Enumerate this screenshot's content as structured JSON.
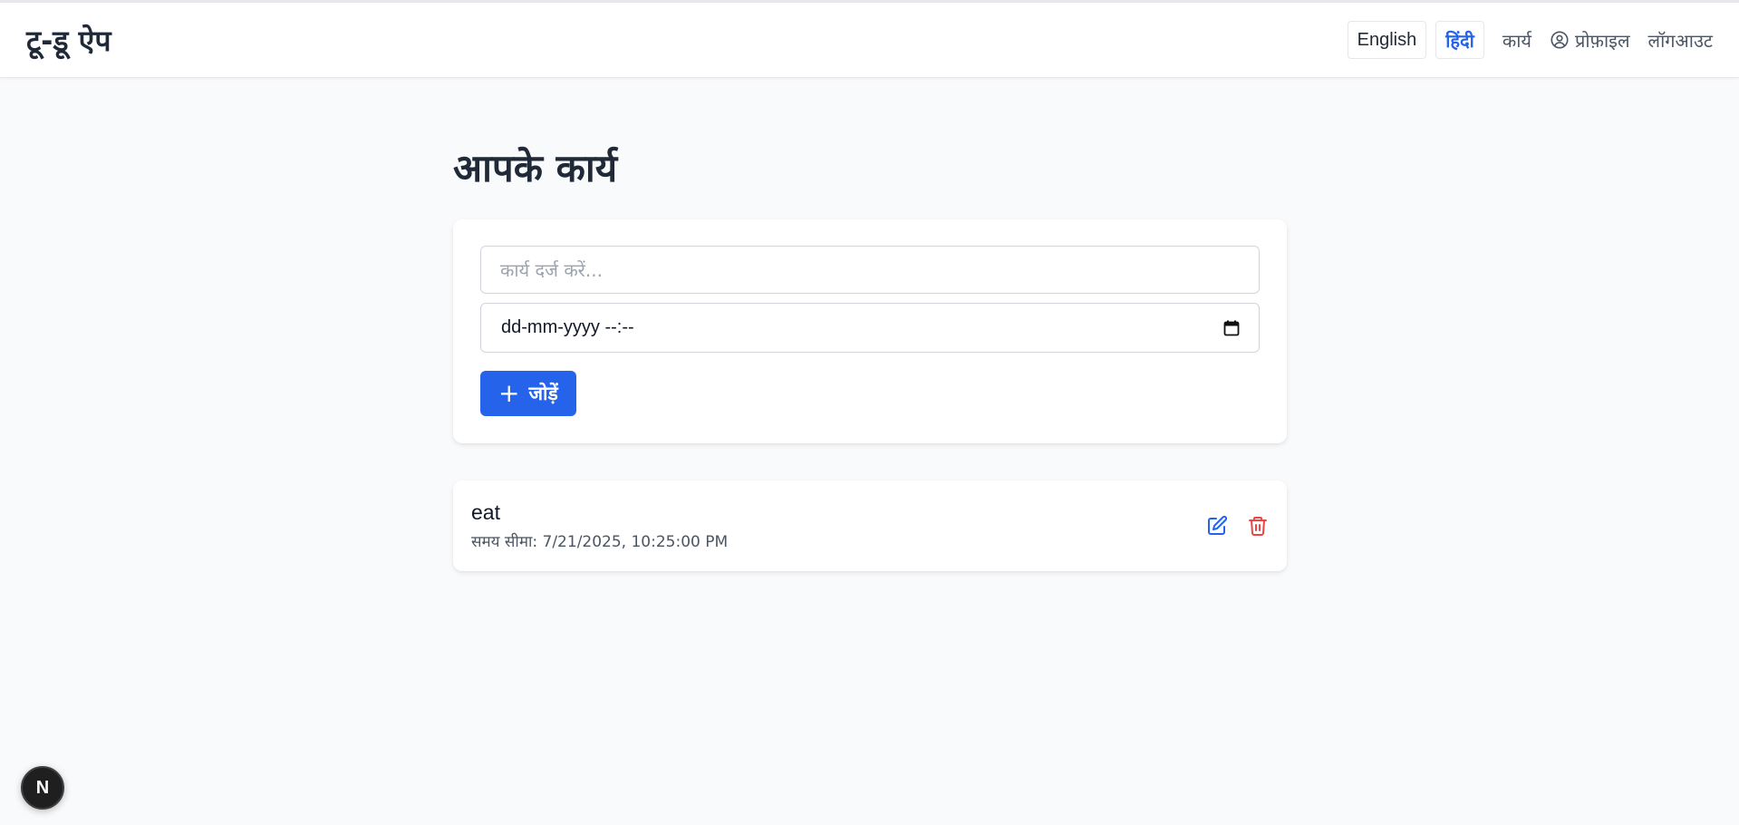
{
  "app": {
    "brand": "टू-डू ऐप"
  },
  "nav": {
    "lang_english": "English",
    "lang_hindi": "हिंदी",
    "tasks_link": "कार्य",
    "profile_link": "प्रोफ़ाइल",
    "logout_link": "लॉगआउट",
    "active_language": "हिंदी"
  },
  "main": {
    "title": "आपके कार्य",
    "form": {
      "task_placeholder": "कार्य दर्ज करें...",
      "task_value": "",
      "datetime_placeholder": "dd-mm-yyyy --:--",
      "add_button": "जोड़ें"
    },
    "tasks": [
      {
        "title": "eat",
        "due_text": "समय सीमा: 7/21/2025, 10:25:00 PM"
      }
    ]
  },
  "dev_badge": {
    "label": "N"
  },
  "colors": {
    "accent": "#2563eb",
    "danger": "#ef4444",
    "background": "#f9fafb",
    "text_dark": "#1f2937",
    "text_muted": "#4b5563"
  },
  "icons": {
    "profile": "user-circle-icon",
    "calendar": "calendar-icon",
    "add": "plus-icon",
    "edit": "pencil-square-icon",
    "delete": "trash-icon"
  }
}
